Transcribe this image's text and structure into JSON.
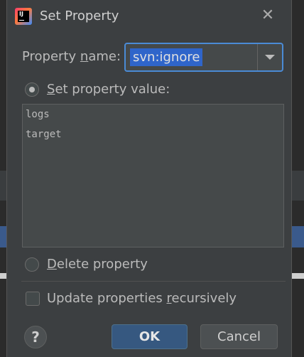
{
  "dialog": {
    "title": "Set Property",
    "close_glyph": "✕",
    "property_name": {
      "label_pre": "Property ",
      "label_mnemonic": "n",
      "label_post": "ame:",
      "value": "svn:ignore"
    },
    "set_value_option": {
      "label_mnemonic": "S",
      "label_post": "et property value:",
      "selected": true
    },
    "property_value_lines": [
      "logs",
      "target"
    ],
    "delete_option": {
      "label_mnemonic": "D",
      "label_post": "elete property",
      "selected": false
    },
    "recursive_option": {
      "label_pre": "Update properties ",
      "label_mnemonic": "r",
      "label_post": "ecursively",
      "checked": false
    },
    "help_label": "?",
    "ok_label": "OK",
    "cancel_label": "Cancel"
  },
  "colors": {
    "dialog_bg": "#3c3f41",
    "selection": "#2f65ca",
    "focus_border": "#4a8bd6",
    "ok_button": "#365880"
  },
  "icons": {
    "app": "intellij-idea-icon",
    "close": "close-icon",
    "dropdown": "chevron-down-icon",
    "help": "help-icon"
  }
}
